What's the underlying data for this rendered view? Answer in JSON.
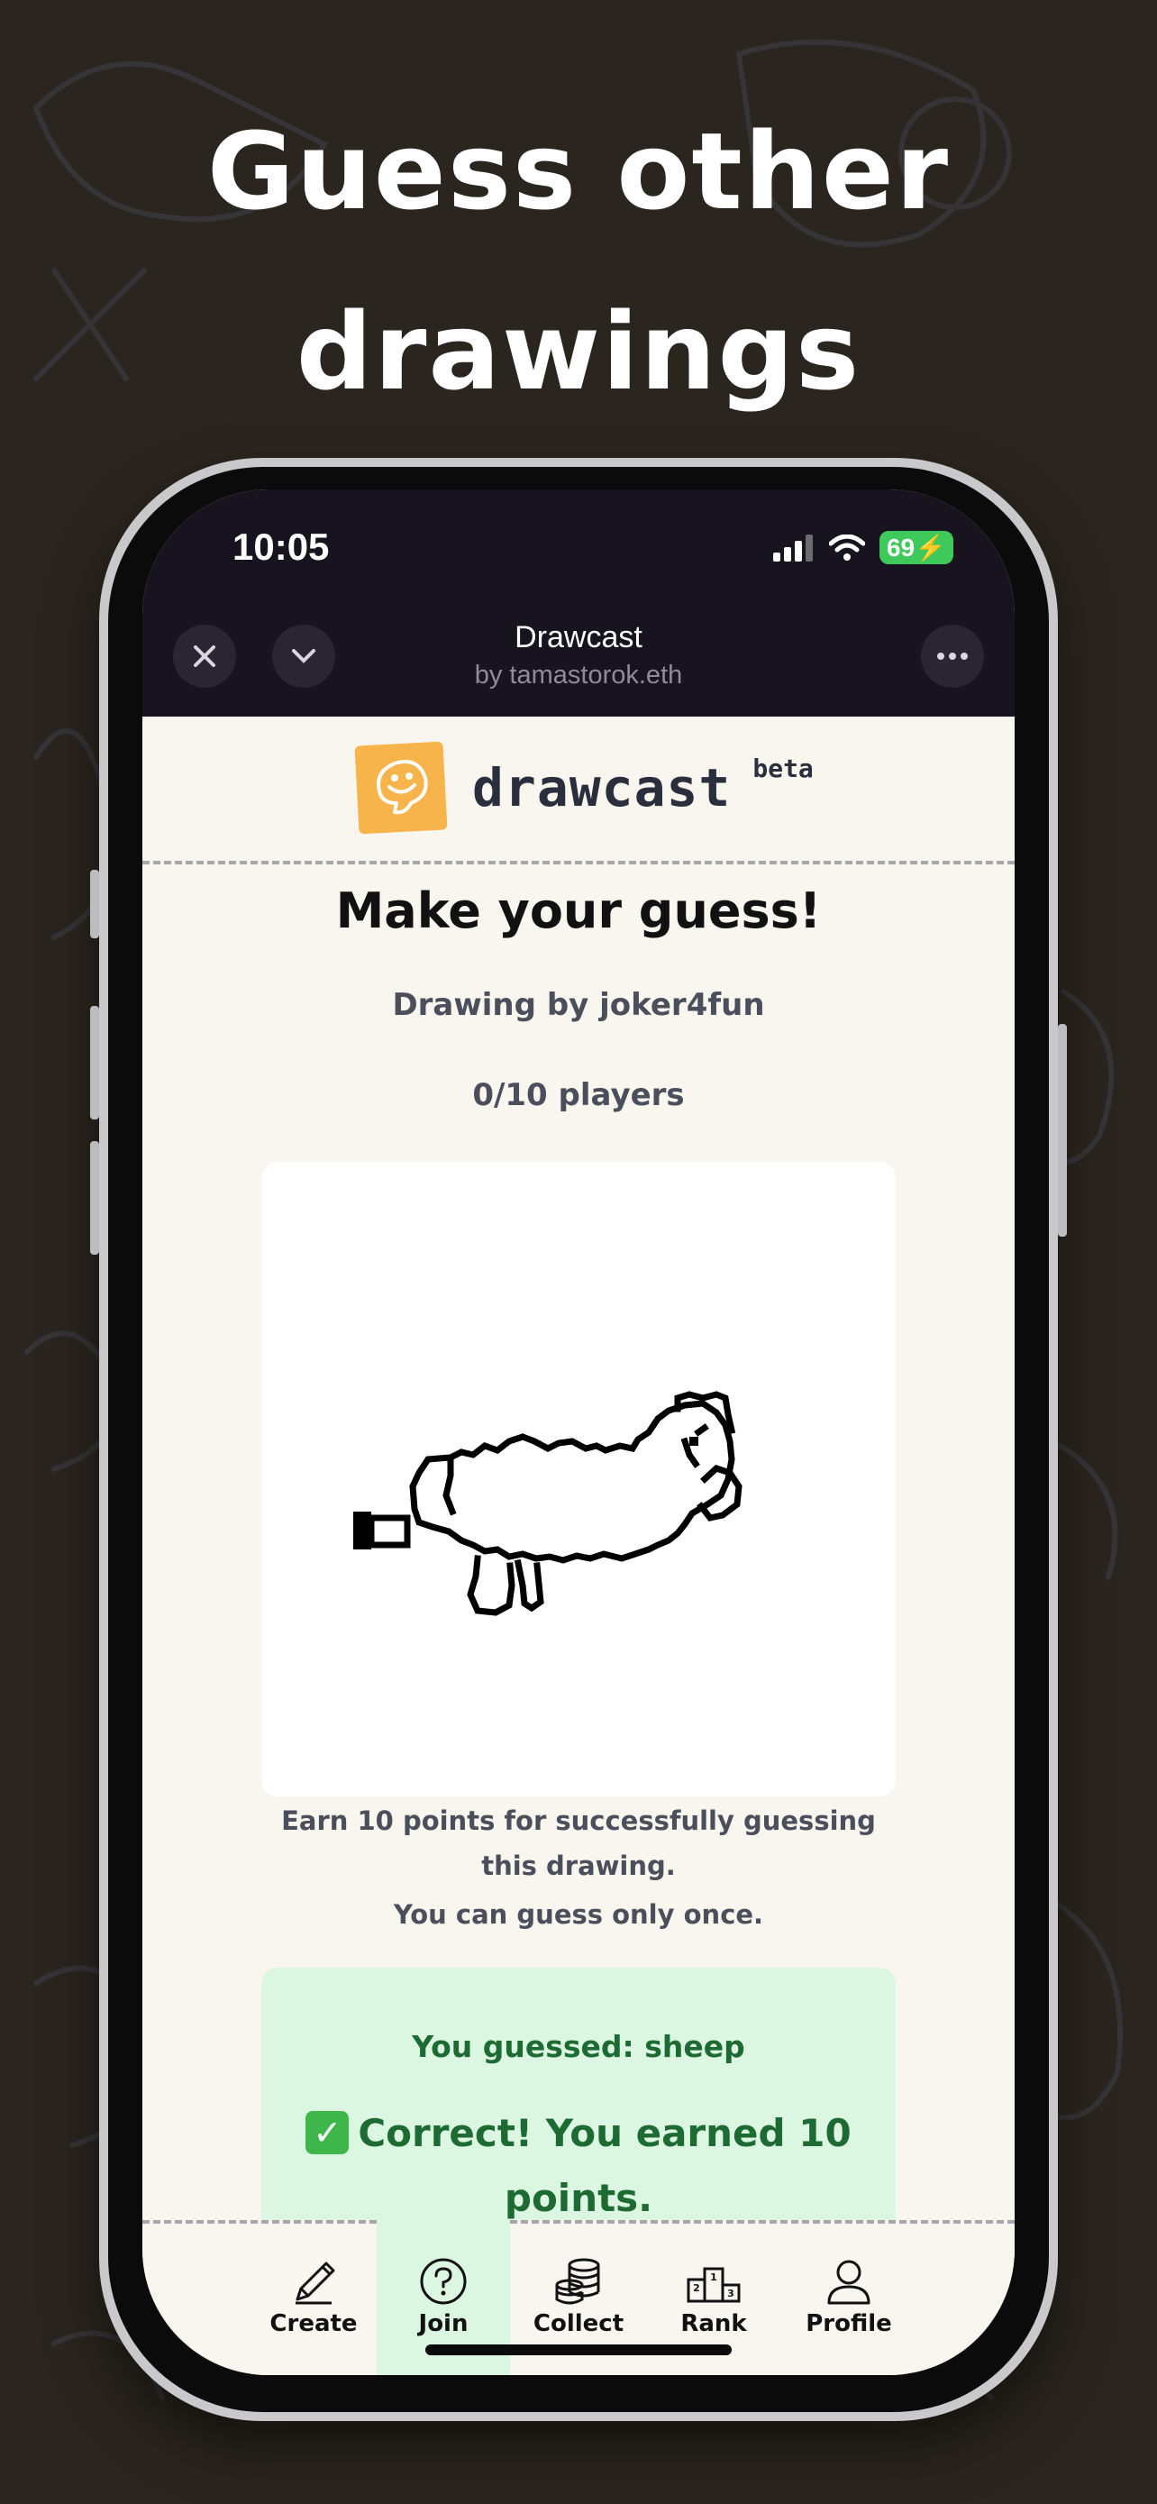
{
  "headline": {
    "line1": "Guess other",
    "line2": "drawings"
  },
  "status": {
    "time": "10:05",
    "battery": "69"
  },
  "webapp": {
    "title": "Drawcast",
    "subtitle": "by tamastorok.eth",
    "icons": {
      "close": "close-icon",
      "collapse": "chevron-down-icon",
      "more": "more-icon"
    }
  },
  "brand": {
    "name": "drawcast",
    "tag": "beta"
  },
  "game": {
    "heading": "Make your guess!",
    "artist": "Drawing by joker4fun",
    "players": "0/10 players",
    "info_line1": "Earn 10 points for successfully guessing this drawing.",
    "info_line2": "You can guess only once.",
    "guess_result": "You guessed: sheep",
    "correct_text": "Correct! You earned 10 points.",
    "check_icon": "✓"
  },
  "tabs": [
    {
      "label": "Create",
      "icon": "pencil-icon",
      "active": false
    },
    {
      "label": "Join",
      "icon": "question-icon",
      "active": true
    },
    {
      "label": "Collect",
      "icon": "coins-icon",
      "active": false
    },
    {
      "label": "Rank",
      "icon": "podium-icon",
      "active": false
    },
    {
      "label": "Profile",
      "icon": "user-icon",
      "active": false
    }
  ],
  "colors": {
    "background": "#2a251e",
    "topbar": "#17131f",
    "screen": "#f8f6ef",
    "success_bg": "#dcf7e1",
    "success_text": "#1d6a33",
    "brand_logo": "#f7b44b"
  }
}
